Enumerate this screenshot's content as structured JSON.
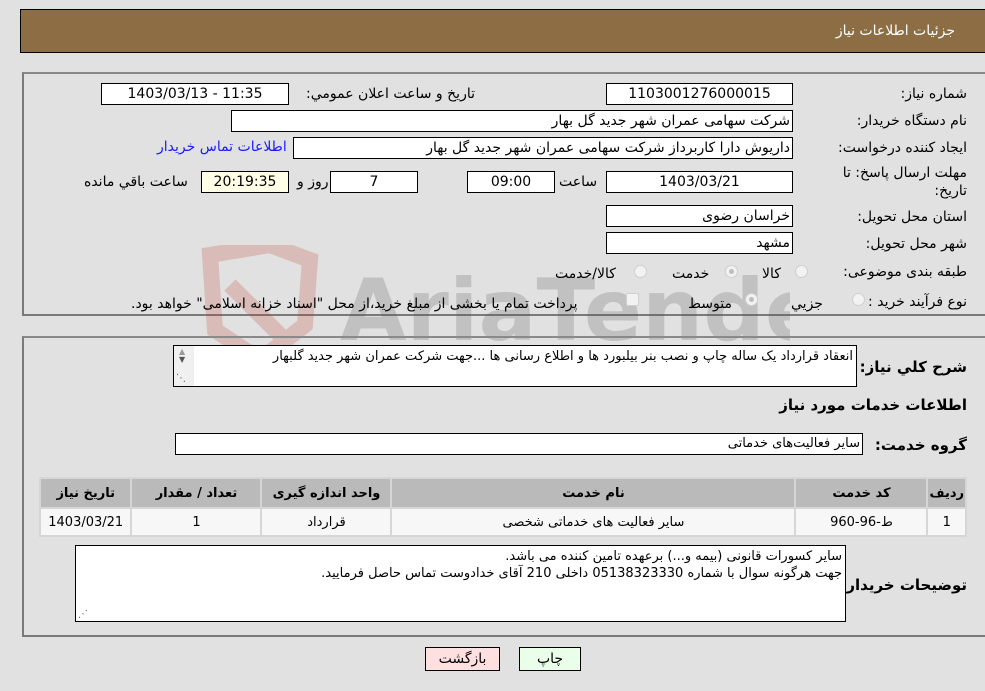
{
  "header": {
    "title": "جزئیات اطلاعات نیاز"
  },
  "details": {
    "need_number": {
      "label": "شماره نیاز:",
      "value": "1103001276000015"
    },
    "announce_datetime": {
      "label": "تاریخ و ساعت اعلان عمومي:",
      "value": "1403/03/13 - 11:35"
    },
    "buyer_org": {
      "label": "نام دستگاه خريدار:",
      "value": "شركت سهامی عمران شهر جدید گل بهار"
    },
    "creator": {
      "label": "ايجاد کننده درخواست:",
      "value": "داریوش دارا کاربرداز شركت سهامی عمران شهر جدید گل بهار"
    },
    "buyer_contact_link": "اطلاعات تماس خريدار",
    "deadline": {
      "label": "مهلت ارسال پاسخ: تا تاریخ:",
      "date": "1403/03/21",
      "time_label": "ساعت",
      "time": "09:00",
      "days": "7",
      "days_label": "روز و",
      "remaining": "20:19:35",
      "remaining_label": "ساعت باقي مانده"
    },
    "province": {
      "label": "استان محل تحویل:",
      "value": "خراسان رضوی"
    },
    "city": {
      "label": "شهر محل تحویل:",
      "value": "مشهد"
    },
    "category": {
      "label": "طبقه بندی موضوعی:",
      "options": [
        {
          "label": "کالا",
          "checked": false
        },
        {
          "label": "خدمت",
          "checked": true
        },
        {
          "label": "کالا/خدمت",
          "checked": false
        }
      ]
    },
    "purchase_process": {
      "label": "نوع فرآیند خرید :",
      "options": [
        {
          "label": "جزيي",
          "checked": false
        },
        {
          "label": "متوسط",
          "checked": true
        }
      ],
      "treasury_checkbox_label": "پرداخت تمام یا بخشی از مبلغ خرید،از محل \"اسناد خزانه اسلامی\" خواهد بود.",
      "treasury_checked": false
    }
  },
  "description": {
    "label": "شرح كلي نياز:",
    "value": "انعقاد قرارداد یک ساله چاپ و نصب بنر بیلبورد ها و اطلاع رسانی ها ...جهت شرکت عمران شهر جدید گلبهار"
  },
  "services_section": {
    "title": "اطلاعات خدمات مورد نياز",
    "group_label": "گروه خدمت:",
    "group_value": "سایر فعالیت‌های خدماتی"
  },
  "table": {
    "columns": [
      "رديف",
      "کد خدمت",
      "نام خدمت",
      "واحد اندازه گیری",
      "تعداد / مقدار",
      "تاریخ نیاز"
    ],
    "rows": [
      [
        "1",
        "ط-96-960",
        "سایر فعالیت های خدماتی شخصی",
        "قرارداد",
        "1",
        "1403/03/21"
      ]
    ]
  },
  "buyer_notes": {
    "label": "توضیحات خریدار:",
    "lines": [
      "سایر کسورات قانونی (بیمه و...) برعهده تامین کننده می باشد.",
      "جهت هرگونه سوال با شماره 05138323330 داخلی 210 آقای خدادوست تماس حاصل فرمایید."
    ]
  },
  "buttons": {
    "print": "چاپ",
    "back": "بازگشت"
  },
  "watermark": {
    "text": "AriaTender.neT"
  },
  "colors": {
    "header_bg": "#8c6d44",
    "page_bg": "#e1e1e1",
    "link": "#1a1aff",
    "back_btn": "#ffe0e0",
    "print_btn": "#eaffea",
    "remaining_bg": "#ffffe8"
  }
}
